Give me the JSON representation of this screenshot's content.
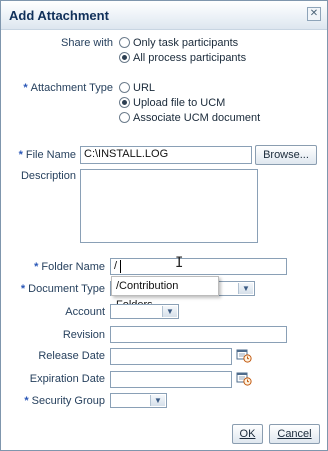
{
  "dialog": {
    "title": "Add Attachment",
    "close_glyph": "✕"
  },
  "share_with": {
    "label": "Share with",
    "options": [
      {
        "label": "Only task participants",
        "selected": false
      },
      {
        "label": "All process participants",
        "selected": true
      }
    ]
  },
  "attachment_type": {
    "required": "*",
    "label": "Attachment Type",
    "options": [
      {
        "label": "URL",
        "selected": false
      },
      {
        "label": "Upload file to UCM",
        "selected": true
      },
      {
        "label": "Associate UCM document",
        "selected": false
      }
    ]
  },
  "file_name": {
    "required": "*",
    "label": "File Name",
    "value": "C:\\INSTALL.LOG",
    "browse_label": "Browse..."
  },
  "description": {
    "label": "Description",
    "value": ""
  },
  "folder_name": {
    "required": "*",
    "label": "Folder Name",
    "value": "/",
    "suggestion": "/Contribution Folders"
  },
  "document_type": {
    "required": "*",
    "label": "Document Type",
    "value": ""
  },
  "account": {
    "label": "Account",
    "value": ""
  },
  "revision": {
    "label": "Revision",
    "value": ""
  },
  "release_date": {
    "label": "Release Date",
    "value": "",
    "icon": "calendar-icon"
  },
  "expiration_date": {
    "label": "Expiration Date",
    "value": "",
    "icon": "calendar-icon"
  },
  "security_group": {
    "required": "*",
    "label": "Security Group",
    "value": ""
  },
  "buttons": {
    "ok": "OK",
    "cancel": "Cancel"
  },
  "colors": {
    "title": "#10305a",
    "required_marker": "#2a57b7",
    "border": "#8aa0b6"
  }
}
